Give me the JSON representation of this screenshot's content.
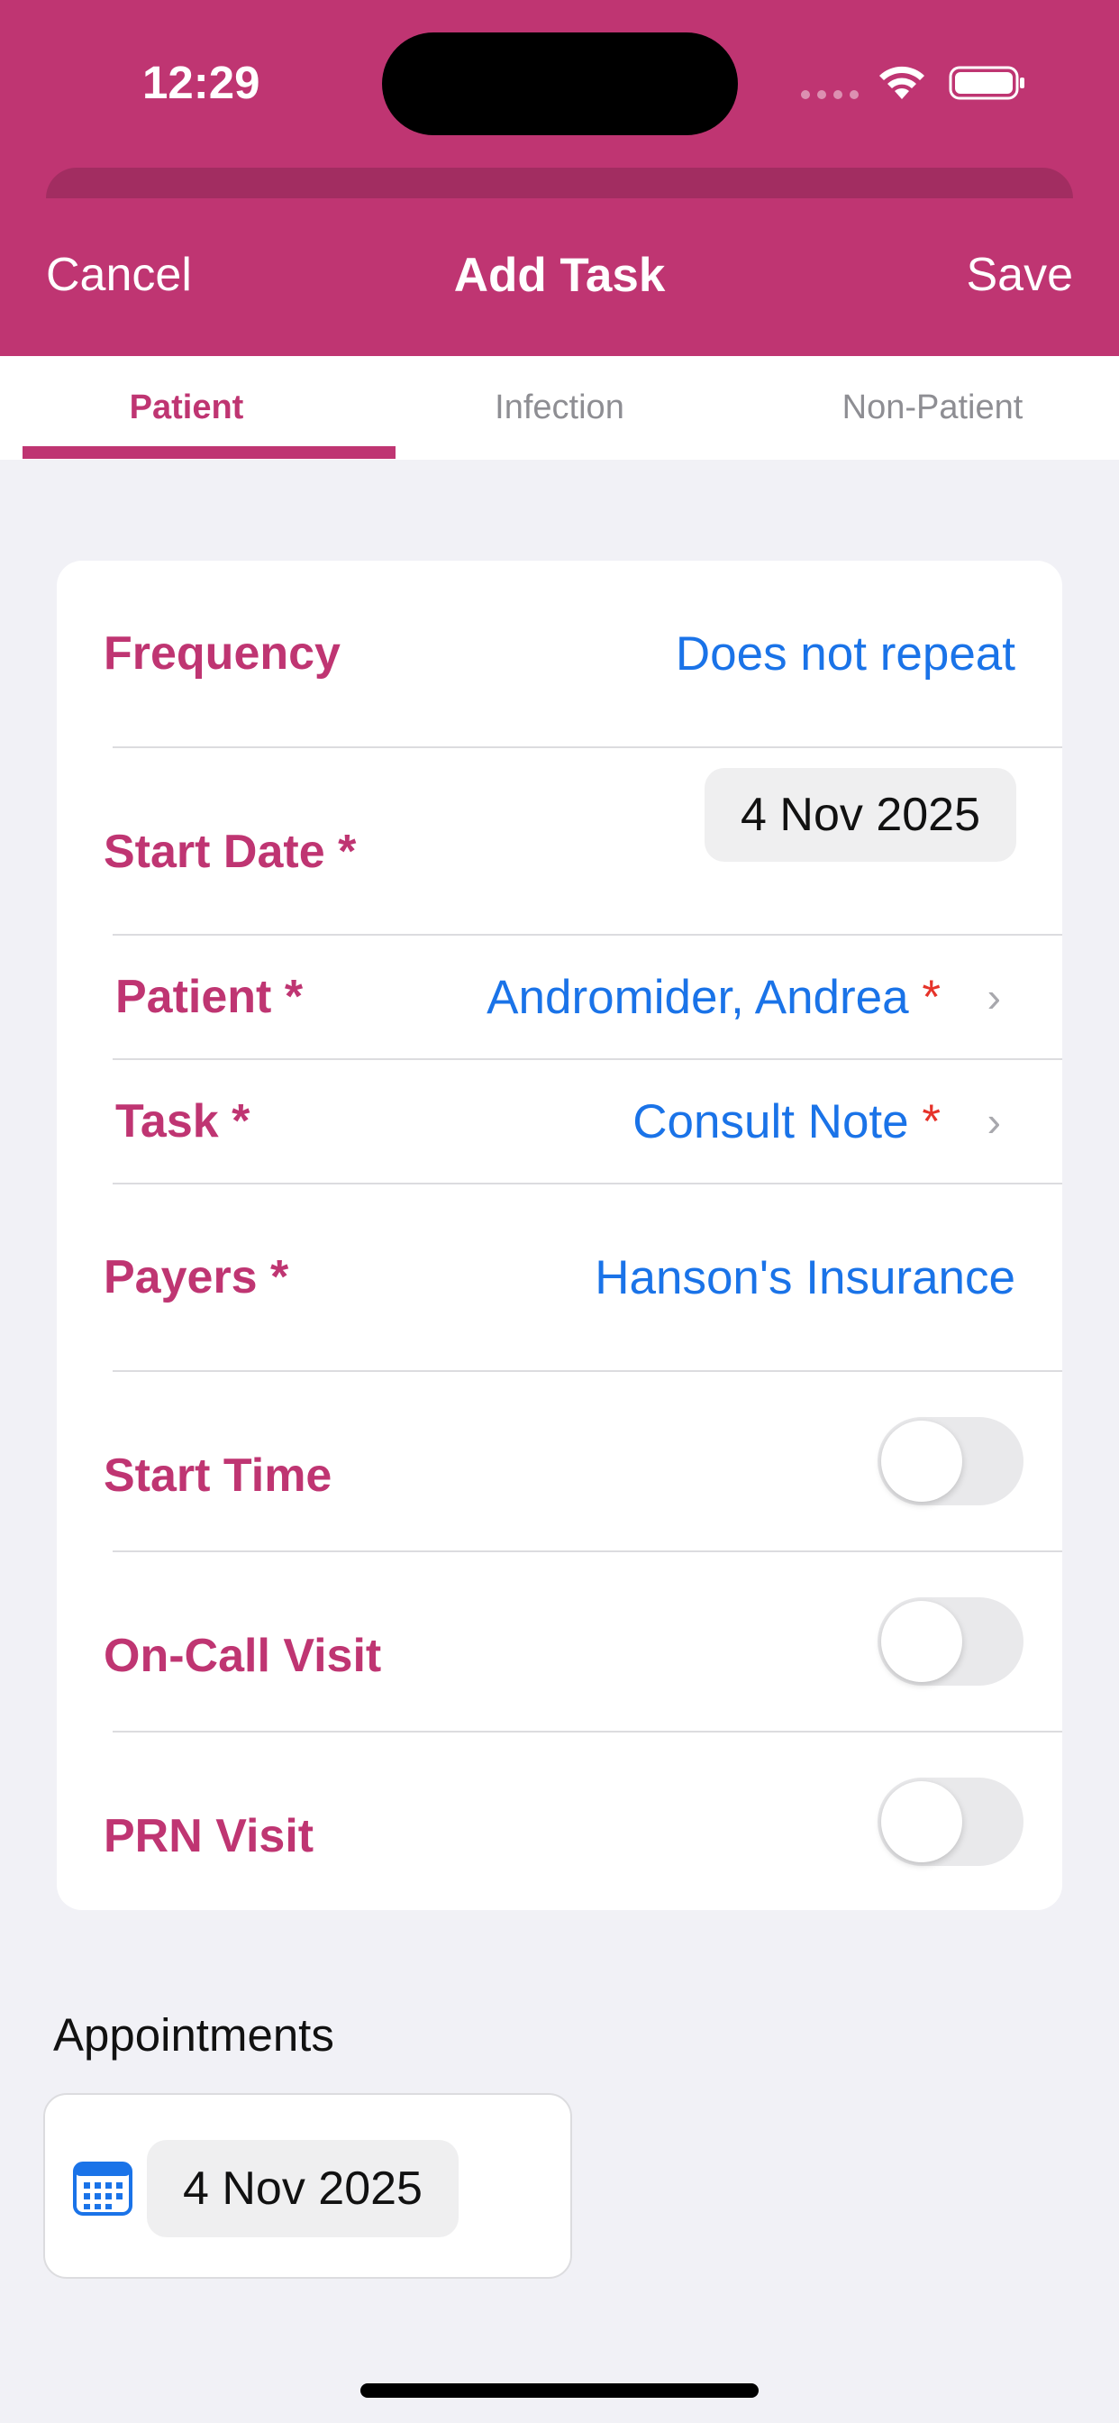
{
  "status_bar": {
    "time": "12:29"
  },
  "nav": {
    "cancel": "Cancel",
    "title": "Add Task",
    "save": "Save"
  },
  "tabs": [
    {
      "label": "Patient",
      "active": true
    },
    {
      "label": "Infection",
      "active": false
    },
    {
      "label": "Non-Patient",
      "active": false
    }
  ],
  "form": {
    "frequency": {
      "label": "Frequency",
      "value": "Does not repeat"
    },
    "start_date": {
      "label": "Start Date *",
      "value": "4 Nov 2025"
    },
    "patient": {
      "label": "Patient *",
      "value": "Andromider, Andrea",
      "required_mark": "*"
    },
    "task": {
      "label": "Task *",
      "value": "Consult Note",
      "required_mark": "*"
    },
    "payers": {
      "label": "Payers *",
      "value": "Hanson's Insurance"
    },
    "start_time": {
      "label": "Start Time",
      "on": false
    },
    "on_call_visit": {
      "label": "On-Call Visit",
      "on": false
    },
    "prn_visit": {
      "label": "PRN Visit",
      "on": false
    }
  },
  "appointments": {
    "title": "Appointments",
    "date": "4 Nov 2025"
  },
  "colors": {
    "brand": "#bf3572",
    "link": "#1a73e8",
    "required": "#e6332a"
  },
  "icons": [
    "wifi-icon",
    "battery-icon",
    "chevron-right-icon",
    "calendar-icon"
  ]
}
